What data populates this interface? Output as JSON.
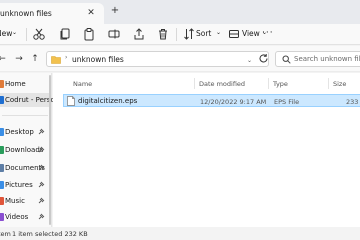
{
  "window": {
    "tab_title": "unknown files",
    "tab_close_glyph": "✕",
    "new_tab_glyph": "+"
  },
  "toolbar": {
    "new_label": "New",
    "sort_label": "Sort",
    "view_label": "View",
    "more_glyph": "···",
    "chevron_glyph": "⌄"
  },
  "addressbar": {
    "back_glyph": "←",
    "forward_glyph": "→",
    "up_glyph": "↑",
    "separator_glyph": "›",
    "path": "unknown files",
    "dropdown_glyph": "⌄",
    "search_placeholder": "Search unknown files"
  },
  "sidebar": {
    "items": [
      {
        "label": "Home",
        "icon": "home-icon",
        "color": "#e07b39",
        "pinned": false
      },
      {
        "label": "Codrut - Person",
        "icon": "cloud-icon",
        "color": "#1f6fd1",
        "pinned": false
      },
      {
        "label": "Desktop",
        "icon": "desktop-icon",
        "color": "#3a8ee6",
        "pinned": true
      },
      {
        "label": "Downloads",
        "icon": "downloads-icon",
        "color": "#2a9d5c",
        "pinned": true
      },
      {
        "label": "Documents",
        "icon": "documents-icon",
        "color": "#5f7fa6",
        "pinned": true
      },
      {
        "label": "Pictures",
        "icon": "pictures-icon",
        "color": "#3a8ee6",
        "pinned": true
      },
      {
        "label": "Music",
        "icon": "music-icon",
        "color": "#e0553a",
        "pinned": true
      },
      {
        "label": "Videos",
        "icon": "videos-icon",
        "color": "#8a4fd1",
        "pinned": true
      }
    ]
  },
  "content": {
    "columns": [
      "Name",
      "Date modified",
      "Type",
      "Size"
    ],
    "files": [
      {
        "name": "digitalcitizen.eps",
        "date": "12/20/2022 9:17 AM",
        "type": "EPS File",
        "size": "233",
        "selected": true
      }
    ]
  },
  "statusbar": {
    "item_count": "1 item",
    "selected_info": "1 item selected  232 KB"
  },
  "colors": {
    "accent": "#0067c0",
    "selection_bg": "#cce8ff",
    "selection_border": "#99d1ff",
    "folder": "#f2c14e"
  }
}
